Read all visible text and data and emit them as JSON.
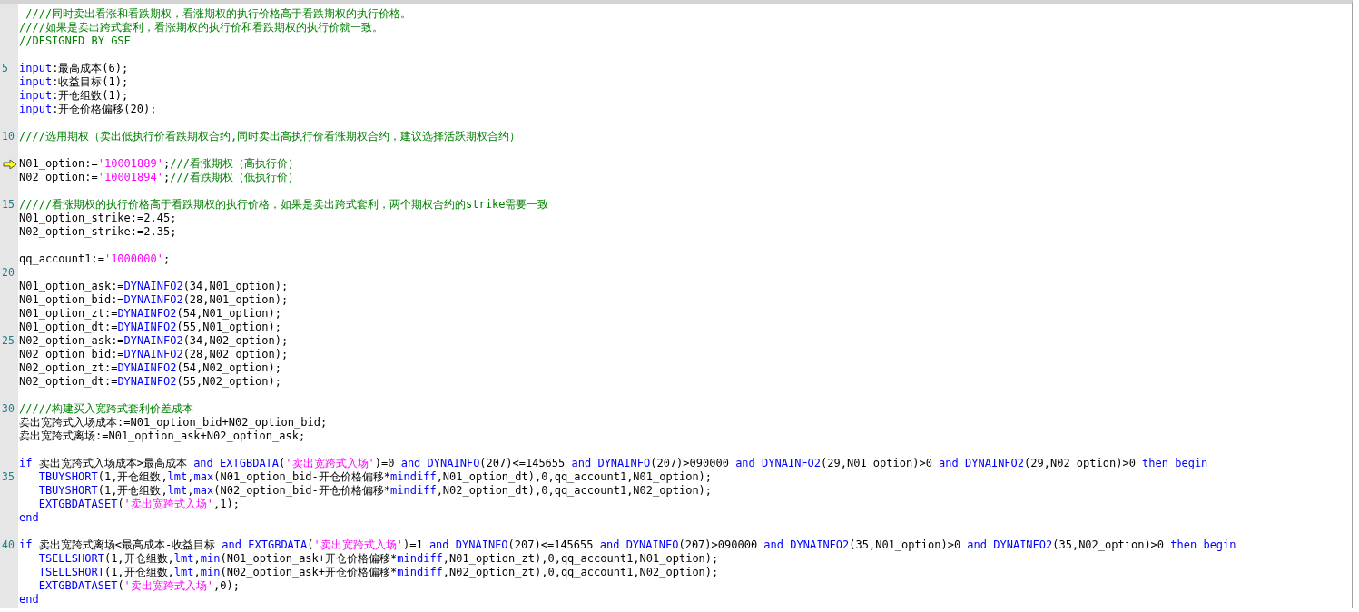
{
  "editor": {
    "lines": [
      {
        "current": false,
        "tokens": [
          {
            "kind": "comment",
            "text": " ////同时卖出看涨和看跌期权，看涨期权的执行价格高于看跌期权的执行价格。"
          }
        ]
      },
      {
        "current": false,
        "tokens": [
          {
            "kind": "comment",
            "text": "////如果是卖出跨式套利，看涨期权的执行价和看跌期权的执行价就一致。"
          }
        ]
      },
      {
        "current": false,
        "tokens": [
          {
            "kind": "comment",
            "text": "//DESIGNED BY GSF"
          }
        ]
      },
      {
        "current": false
      },
      {
        "number": "5",
        "current": false,
        "tokens": [
          {
            "kind": "keyword",
            "text": "input"
          },
          {
            "kind": "plain",
            "text": ":最高成本(6);"
          }
        ]
      },
      {
        "current": false,
        "tokens": [
          {
            "kind": "keyword",
            "text": "input"
          },
          {
            "kind": "plain",
            "text": ":收益目标(1);"
          }
        ]
      },
      {
        "current": false,
        "tokens": [
          {
            "kind": "keyword",
            "text": "input"
          },
          {
            "kind": "plain",
            "text": ":开仓组数(1);"
          }
        ]
      },
      {
        "current": false,
        "tokens": [
          {
            "kind": "keyword",
            "text": "input"
          },
          {
            "kind": "plain",
            "text": ":开仓价格偏移(20);"
          }
        ]
      },
      {
        "current": false
      },
      {
        "number": "10",
        "current": false,
        "tokens": [
          {
            "kind": "comment",
            "text": "////选用期权（卖出低执行价看跌期权合约,同时卖出高执行价看涨期权合约，建议选择活跃期权合约）"
          }
        ]
      },
      {
        "current": false
      },
      {
        "current": true,
        "tokens": [
          {
            "kind": "plain",
            "text": "N01_option:="
          },
          {
            "kind": "string",
            "text": "'10001889'"
          },
          {
            "kind": "plain",
            "text": ";"
          },
          {
            "kind": "comment",
            "text": "///看涨期权（高执行价）"
          }
        ]
      },
      {
        "current": false,
        "tokens": [
          {
            "kind": "plain",
            "text": "N02_option:="
          },
          {
            "kind": "string",
            "text": "'10001894'"
          },
          {
            "kind": "plain",
            "text": ";"
          },
          {
            "kind": "comment",
            "text": "///看跌期权（低执行价）"
          }
        ]
      },
      {
        "current": false
      },
      {
        "number": "15",
        "current": false,
        "tokens": [
          {
            "kind": "comment",
            "text": "/////看涨期权的执行价格高于看跌期权的执行价格，如果是卖出跨式套利，两个期权合约的strike需要一致"
          }
        ]
      },
      {
        "current": false,
        "tokens": [
          {
            "kind": "plain",
            "text": "N01_option_strike:=2.45;"
          }
        ]
      },
      {
        "current": false,
        "tokens": [
          {
            "kind": "plain",
            "text": "N02_option_strike:=2.35;"
          }
        ]
      },
      {
        "current": false
      },
      {
        "current": false,
        "tokens": [
          {
            "kind": "plain",
            "text": "qq_account1:="
          },
          {
            "kind": "string",
            "text": "'1000000'"
          },
          {
            "kind": "plain",
            "text": ";"
          }
        ]
      },
      {
        "number": "20",
        "current": false
      },
      {
        "current": false,
        "tokens": [
          {
            "kind": "plain",
            "text": "N01_option_ask:="
          },
          {
            "kind": "keyword",
            "text": "DYNAINFO2"
          },
          {
            "kind": "plain",
            "text": "(34,N01_option);"
          }
        ]
      },
      {
        "current": false,
        "tokens": [
          {
            "kind": "plain",
            "text": "N01_option_bid:="
          },
          {
            "kind": "keyword",
            "text": "DYNAINFO2"
          },
          {
            "kind": "plain",
            "text": "(28,N01_option);"
          }
        ]
      },
      {
        "current": false,
        "tokens": [
          {
            "kind": "plain",
            "text": "N01_option_zt:="
          },
          {
            "kind": "keyword",
            "text": "DYNAINFO2"
          },
          {
            "kind": "plain",
            "text": "(54,N01_option);"
          }
        ]
      },
      {
        "current": false,
        "tokens": [
          {
            "kind": "plain",
            "text": "N01_option_dt:="
          },
          {
            "kind": "keyword",
            "text": "DYNAINFO2"
          },
          {
            "kind": "plain",
            "text": "(55,N01_option);"
          }
        ]
      },
      {
        "number": "25",
        "current": false,
        "tokens": [
          {
            "kind": "plain",
            "text": "N02_option_ask:="
          },
          {
            "kind": "keyword",
            "text": "DYNAINFO2"
          },
          {
            "kind": "plain",
            "text": "(34,N02_option);"
          }
        ]
      },
      {
        "current": false,
        "tokens": [
          {
            "kind": "plain",
            "text": "N02_option_bid:="
          },
          {
            "kind": "keyword",
            "text": "DYNAINFO2"
          },
          {
            "kind": "plain",
            "text": "(28,N02_option);"
          }
        ]
      },
      {
        "current": false,
        "tokens": [
          {
            "kind": "plain",
            "text": "N02_option_zt:="
          },
          {
            "kind": "keyword",
            "text": "DYNAINFO2"
          },
          {
            "kind": "plain",
            "text": "(54,N02_option);"
          }
        ]
      },
      {
        "current": false,
        "tokens": [
          {
            "kind": "plain",
            "text": "N02_option_dt:="
          },
          {
            "kind": "keyword",
            "text": "DYNAINFO2"
          },
          {
            "kind": "plain",
            "text": "(55,N02_option);"
          }
        ]
      },
      {
        "current": false
      },
      {
        "number": "30",
        "current": false,
        "tokens": [
          {
            "kind": "comment",
            "text": "/////构建买入宽跨式套利价差成本"
          }
        ]
      },
      {
        "current": false,
        "tokens": [
          {
            "kind": "plain",
            "text": "卖出宽跨式入场成本:=N01_option_bid+N02_option_bid;"
          }
        ]
      },
      {
        "current": false,
        "tokens": [
          {
            "kind": "plain",
            "text": "卖出宽跨式离场:=N01_option_ask+N02_option_ask;"
          }
        ]
      },
      {
        "current": false
      },
      {
        "current": false,
        "tokens": [
          {
            "kind": "keyword",
            "text": "if"
          },
          {
            "kind": "plain",
            "text": " 卖出宽跨式入场成本>最高成本 "
          },
          {
            "kind": "keyword",
            "text": "and EXTGBDATA"
          },
          {
            "kind": "plain",
            "text": "("
          },
          {
            "kind": "string",
            "text": "'卖出宽跨式入场'"
          },
          {
            "kind": "plain",
            "text": ")=0 "
          },
          {
            "kind": "keyword",
            "text": "and DYNAINFO"
          },
          {
            "kind": "plain",
            "text": "(207)<=145655 "
          },
          {
            "kind": "keyword",
            "text": "and DYNAINFO"
          },
          {
            "kind": "plain",
            "text": "(207)>090000 "
          },
          {
            "kind": "keyword",
            "text": "and DYNAINFO2"
          },
          {
            "kind": "plain",
            "text": "(29,N01_option)>0 "
          },
          {
            "kind": "keyword",
            "text": "and DYNAINFO2"
          },
          {
            "kind": "plain",
            "text": "(29,N02_option)>0 "
          },
          {
            "kind": "keyword",
            "text": "then begin"
          }
        ]
      },
      {
        "number": "35",
        "current": false,
        "tokens": [
          {
            "kind": "keyword",
            "text": "   TBUYSHORT"
          },
          {
            "kind": "plain",
            "text": "(1,开仓组数,"
          },
          {
            "kind": "keyword",
            "text": "lmt"
          },
          {
            "kind": "plain",
            "text": ","
          },
          {
            "kind": "keyword",
            "text": "max"
          },
          {
            "kind": "plain",
            "text": "(N01_option_bid-开仓价格偏移*"
          },
          {
            "kind": "keyword",
            "text": "mindiff"
          },
          {
            "kind": "plain",
            "text": ",N01_option_dt),0,qq_account1,N01_option);"
          }
        ]
      },
      {
        "current": false,
        "tokens": [
          {
            "kind": "keyword",
            "text": "   TBUYSHORT"
          },
          {
            "kind": "plain",
            "text": "(1,开仓组数,"
          },
          {
            "kind": "keyword",
            "text": "lmt"
          },
          {
            "kind": "plain",
            "text": ","
          },
          {
            "kind": "keyword",
            "text": "max"
          },
          {
            "kind": "plain",
            "text": "(N02_option_bid-开仓价格偏移*"
          },
          {
            "kind": "keyword",
            "text": "mindiff"
          },
          {
            "kind": "plain",
            "text": ",N02_option_dt),0,qq_account1,N02_option);"
          }
        ]
      },
      {
        "current": false,
        "tokens": [
          {
            "kind": "keyword",
            "text": "   EXTGBDATASET"
          },
          {
            "kind": "plain",
            "text": "("
          },
          {
            "kind": "string",
            "text": "'卖出宽跨式入场'"
          },
          {
            "kind": "plain",
            "text": ",1);"
          }
        ]
      },
      {
        "current": false,
        "tokens": [
          {
            "kind": "keyword",
            "text": "end"
          }
        ]
      },
      {
        "current": false
      },
      {
        "number": "40",
        "current": false,
        "tokens": [
          {
            "kind": "keyword",
            "text": "if"
          },
          {
            "kind": "plain",
            "text": " 卖出宽跨式离场<最高成本-收益目标 "
          },
          {
            "kind": "keyword",
            "text": "and EXTGBDATA"
          },
          {
            "kind": "plain",
            "text": "("
          },
          {
            "kind": "string",
            "text": "'卖出宽跨式入场'"
          },
          {
            "kind": "plain",
            "text": ")=1 "
          },
          {
            "kind": "keyword",
            "text": "and DYNAINFO"
          },
          {
            "kind": "plain",
            "text": "(207)<=145655 "
          },
          {
            "kind": "keyword",
            "text": "and DYNAINFO"
          },
          {
            "kind": "plain",
            "text": "(207)>090000 "
          },
          {
            "kind": "keyword",
            "text": "and DYNAINFO2"
          },
          {
            "kind": "plain",
            "text": "(35,N01_option)>0 "
          },
          {
            "kind": "keyword",
            "text": "and DYNAINFO2"
          },
          {
            "kind": "plain",
            "text": "(35,N02_option)>0 "
          },
          {
            "kind": "keyword",
            "text": "then begin"
          }
        ]
      },
      {
        "current": false,
        "tokens": [
          {
            "kind": "keyword",
            "text": "   TSELLSHORT"
          },
          {
            "kind": "plain",
            "text": "(1,开仓组数,"
          },
          {
            "kind": "keyword",
            "text": "lmt"
          },
          {
            "kind": "plain",
            "text": ","
          },
          {
            "kind": "keyword",
            "text": "min"
          },
          {
            "kind": "plain",
            "text": "(N01_option_ask+开仓价格偏移*"
          },
          {
            "kind": "keyword",
            "text": "mindiff"
          },
          {
            "kind": "plain",
            "text": ",N01_option_zt),0,qq_account1,N01_option);"
          }
        ]
      },
      {
        "current": false,
        "tokens": [
          {
            "kind": "keyword",
            "text": "   TSELLSHORT"
          },
          {
            "kind": "plain",
            "text": "(1,开仓组数,"
          },
          {
            "kind": "keyword",
            "text": "lmt"
          },
          {
            "kind": "plain",
            "text": ","
          },
          {
            "kind": "keyword",
            "text": "min"
          },
          {
            "kind": "plain",
            "text": "(N02_option_ask+开仓价格偏移*"
          },
          {
            "kind": "keyword",
            "text": "mindiff"
          },
          {
            "kind": "plain",
            "text": ",N02_option_zt),0,qq_account1,N02_option);"
          }
        ]
      },
      {
        "current": false,
        "tokens": [
          {
            "kind": "keyword",
            "text": "   EXTGBDATASET"
          },
          {
            "kind": "plain",
            "text": "("
          },
          {
            "kind": "string",
            "text": "'卖出宽跨式入场'"
          },
          {
            "kind": "plain",
            "text": ",0);"
          }
        ]
      },
      {
        "current": false,
        "tokens": [
          {
            "kind": "keyword",
            "text": "end"
          }
        ]
      }
    ]
  }
}
